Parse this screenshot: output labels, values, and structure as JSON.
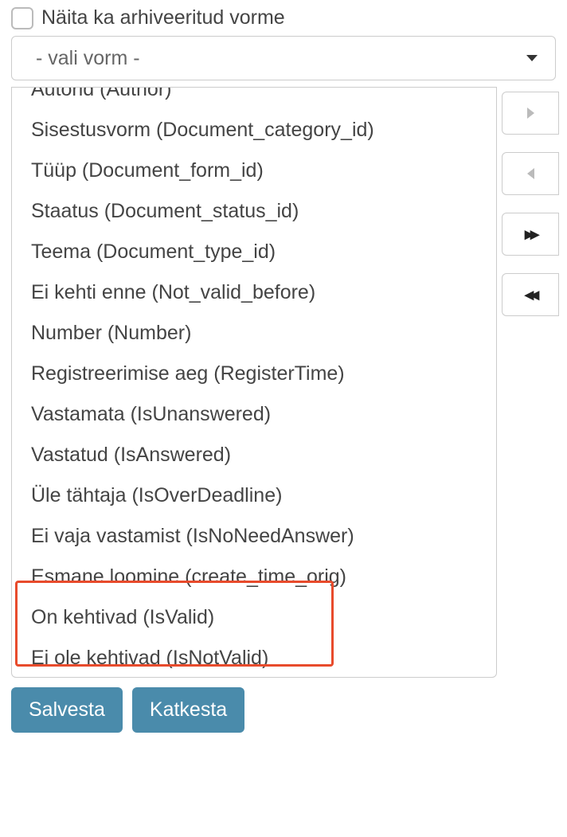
{
  "checkbox": {
    "label": "Näita ka arhiveeritud vorme",
    "checked": false
  },
  "select": {
    "placeholder": "- vali vorm -"
  },
  "listbox": {
    "items": [
      "Autorid (Author)",
      "Sisestusvorm (Document_category_id)",
      "Tüüp (Document_form_id)",
      "Staatus (Document_status_id)",
      "Teema (Document_type_id)",
      "Ei kehti enne (Not_valid_before)",
      "Number (Number)",
      "Registreerimise aeg (RegisterTime)",
      "Vastamata (IsUnanswered)",
      "Vastatud (IsAnswered)",
      "Üle tähtaja (IsOverDeadline)",
      "Ei vaja vastamist (IsNoNeedAnswer)",
      "Esmane loomine (create_time_orig)",
      "On kehtivad (IsValid)",
      "Ei ole kehtivad (IsNotValid)"
    ]
  },
  "buttons": {
    "save": "Salvesta",
    "cancel": "Katkesta"
  },
  "highlight": {
    "color": "#e84b2c"
  }
}
